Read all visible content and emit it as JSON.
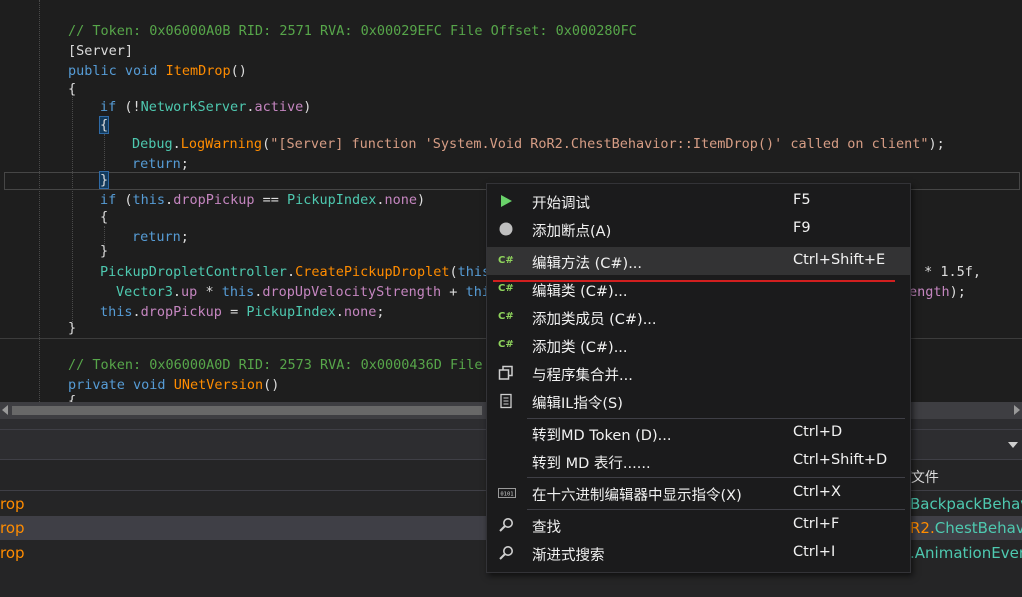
{
  "code": {
    "comment1": "// Token: 0x06000A0B RID: 2571 RVA: 0x00029EFC File Offset: 0x000280FC",
    "attr_server": "[Server]",
    "kw_public": "public",
    "kw_void": "void",
    "method1": "ItemDrop",
    "parens": "()",
    "brace_open": "{",
    "brace_close": "}",
    "kw_if": "if",
    "bang_open": " (!",
    "network_server": "NetworkServer",
    "dot": ".",
    "active": "active",
    "close_paren": ")",
    "debug": "Debug",
    "log_warning": "LogWarning",
    "open_paren": "(",
    "warning_string": "\"[Server] function 'System.Void RoR2.ChestBehavior::ItemDrop()' called on client\"",
    "paren_semi": ");",
    "kw_return": "return",
    "semi": ";",
    "open_paren_sp": " (",
    "kw_this": "this",
    "drop_pickup": "dropPickup",
    "eq_eq": " == ",
    "pickup_index": "PickupIndex",
    "none": "none",
    "pdc": "PickupDropletController",
    "create_pd": "CreatePickupDroplet",
    "frag_this": "this",
    "frag_tail1": " * 1.5f,",
    "vector3": "Vector3",
    "up": "up",
    "times": " * ",
    "drop_up_vs": "dropUpVelocityStrength",
    "plus": " + ",
    "frag_thi": "thi",
    "frag_tail2a": "ength",
    "frag_tail2b": ");",
    "assign": " = ",
    "comment2": "// Token: 0x06000A0D RID: 2573 RVA: 0x0000436D File O",
    "kw_private": "private",
    "method2": "UNetVersion"
  },
  "panel": {
    "column_fragment": "f文件",
    "rows": [
      {
        "left": "rop",
        "right_prefix": "",
        "right_rest": "BackpackBehavi"
      },
      {
        "left": "rop",
        "right_prefix": "R2.",
        "right_rest": "ChestBehavi"
      },
      {
        "left": "rop",
        "right_prefix": "",
        "right_rest": ".AnimationEven"
      }
    ]
  },
  "context_menu": {
    "items": [
      {
        "label": "开始调试",
        "shortcut": "F5",
        "icon": "play-icon"
      },
      {
        "label": "添加断点(A)",
        "shortcut": "F9",
        "icon": "breakpoint-icon"
      },
      {
        "label": "编辑方法 (C#)...",
        "shortcut": "Ctrl+Shift+E",
        "icon": "csharp-icon",
        "highlighted": true
      },
      {
        "label": "编辑类 (C#)...",
        "shortcut": "",
        "icon": "csharp-icon"
      },
      {
        "label": "添加类成员 (C#)...",
        "shortcut": "",
        "icon": "csharp-icon"
      },
      {
        "label": "添加类 (C#)...",
        "shortcut": "",
        "icon": "csharp-icon"
      },
      {
        "label": "与程序集合并...",
        "shortcut": "",
        "icon": "merge-assembly-icon"
      },
      {
        "label": "编辑IL指令(S)",
        "shortcut": "",
        "icon": "il-document-icon"
      },
      {
        "label": "转到MD Token (D)...",
        "shortcut": "Ctrl+D",
        "icon": ""
      },
      {
        "label": "转到 MD 表行......",
        "shortcut": "Ctrl+Shift+D",
        "icon": ""
      },
      {
        "label": "在十六进制编辑器中显示指令(X)",
        "shortcut": "Ctrl+X",
        "icon": "hex-editor-icon"
      },
      {
        "label": "查找",
        "shortcut": "Ctrl+F",
        "icon": "search-icon"
      },
      {
        "label": "渐进式搜索",
        "shortcut": "Ctrl+I",
        "icon": "incremental-search-icon"
      }
    ],
    "csharp_icon_text": "C#"
  },
  "colors": {
    "comment": "#57a64a",
    "keyword": "#569cd6",
    "type": "#4ec9b0",
    "method": "#ff8c00",
    "property": "#c586c0",
    "string": "#d69d85",
    "highlight_underline": "#d11f1f"
  }
}
